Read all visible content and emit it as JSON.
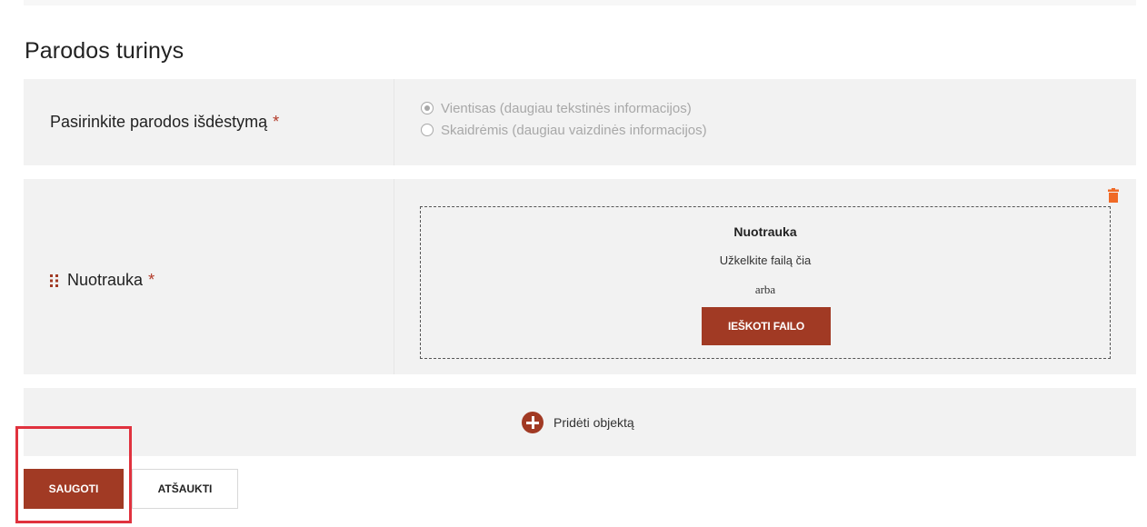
{
  "section_title": "Parodos turinys",
  "layout_field": {
    "label": "Pasirinkite parodos išdėstymą",
    "required_mark": "*",
    "options": [
      {
        "label": "Vientisas (daugiau tekstinės informacijos)",
        "selected": true
      },
      {
        "label": "Skaidrėmis (daugiau vaizdinės informacijos)",
        "selected": false
      }
    ]
  },
  "photo_field": {
    "label": "Nuotrauka",
    "required_mark": "*",
    "drag_icon": "drag-handle-icon",
    "delete_icon": "trash-icon",
    "dropzone": {
      "title": "Nuotrauka",
      "instruction": "Užkelkite failą čia",
      "or_text": "arba",
      "browse_label": "IEŠKOTI FAILO"
    }
  },
  "add_object": {
    "icon": "plus-circle-icon",
    "label": "Pridėti objektą"
  },
  "actions": {
    "save_label": "SAUGOTI",
    "cancel_label": "ATŠAUKTI"
  },
  "colors": {
    "primary": "#a13a24",
    "required": "#b23a28",
    "trash": "#f06a26",
    "highlight": "#e0323e",
    "panel_bg": "#f2f2f2"
  }
}
